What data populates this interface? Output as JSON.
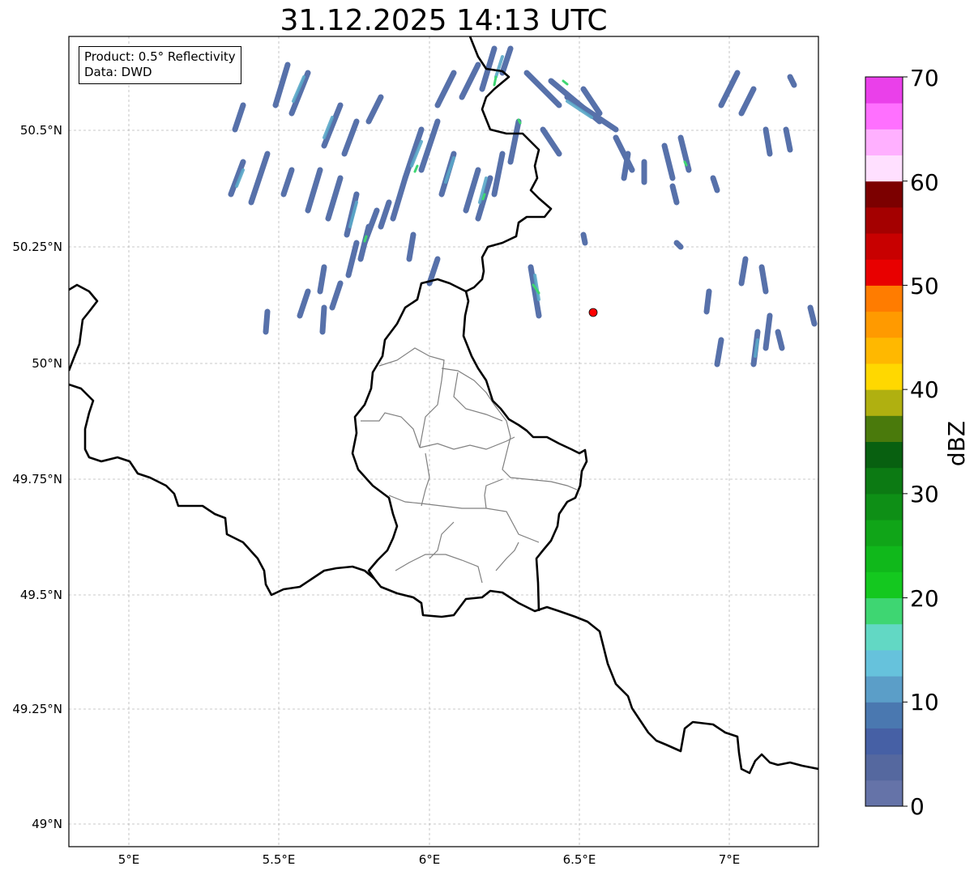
{
  "title": "31.12.2025 14:13 UTC",
  "info_box": {
    "line1": "Product: 0.5° Reflectivity",
    "line2": "Data: DWD"
  },
  "map": {
    "lon_ticks": [
      "5°E",
      "5.5°E",
      "6°E",
      "6.5°E",
      "7°E"
    ],
    "lat_ticks": [
      "50.5°N",
      "50.25°N",
      "50°N",
      "49.75°N",
      "49.5°N",
      "49.25°N",
      "49°N"
    ],
    "lon_range": [
      4.8,
      7.3
    ],
    "lat_range": [
      48.95,
      50.7
    ],
    "gridlines": true,
    "radar_site_color": "#ff0000"
  },
  "colorbar": {
    "label": "dBZ",
    "ticks": [
      "0",
      "10",
      "20",
      "30",
      "40",
      "50",
      "60",
      "70"
    ],
    "range": [
      0,
      70
    ],
    "colors": [
      "#6573a8",
      "#55689f",
      "#4660a5",
      "#4a78b0",
      "#5b9ec8",
      "#66c2dc",
      "#62d8c4",
      "#3ed672",
      "#14c81f",
      "#10b81b",
      "#10a518",
      "#0e8f16",
      "#0c7a13",
      "#086010",
      "#4a7a0c",
      "#b0b010",
      "#ffd800",
      "#ffb800",
      "#ff9a00",
      "#ff7c00",
      "#e80000",
      "#c80000",
      "#a40000",
      "#7c0000",
      "#ffe0ff",
      "#ffb0ff",
      "#ff70ff",
      "#ea40ea"
    ]
  }
}
